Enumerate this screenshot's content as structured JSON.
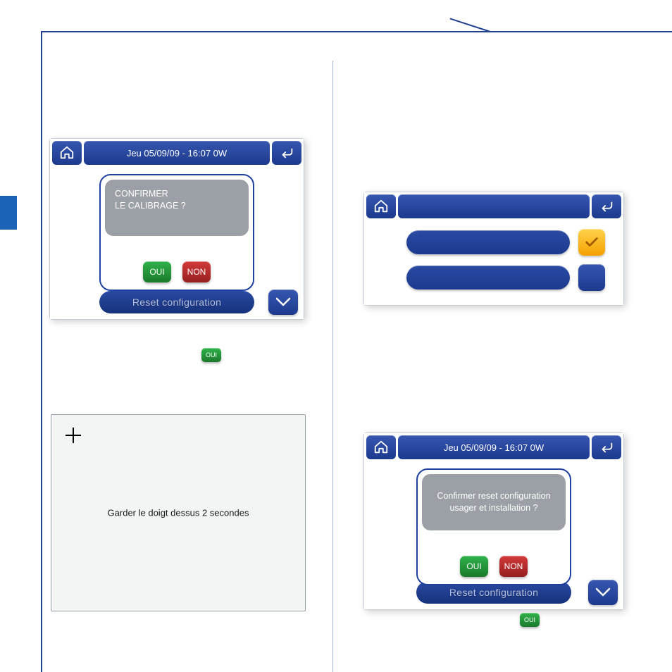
{
  "screen1": {
    "title": "Jeu 05/09/09 - 16:07   0W",
    "modal_text": "CONFIRMER\nLE CALIBRAGE ?",
    "oui": "OUI",
    "non": "NON",
    "bg_label": "Reset configuration"
  },
  "help": {
    "oui": "OUI",
    "oui2": "OUI"
  },
  "calib": {
    "hint": "Garder le doigt dessus 2 secondes"
  },
  "screen2": {
    "title": ""
  },
  "screen3": {
    "title": "Jeu 05/09/09 - 16:07   0W",
    "modal_text": "Confirmer reset configuration usager et installation ?",
    "oui": "OUI",
    "non": "NON",
    "bg_label": "Reset configuration"
  }
}
